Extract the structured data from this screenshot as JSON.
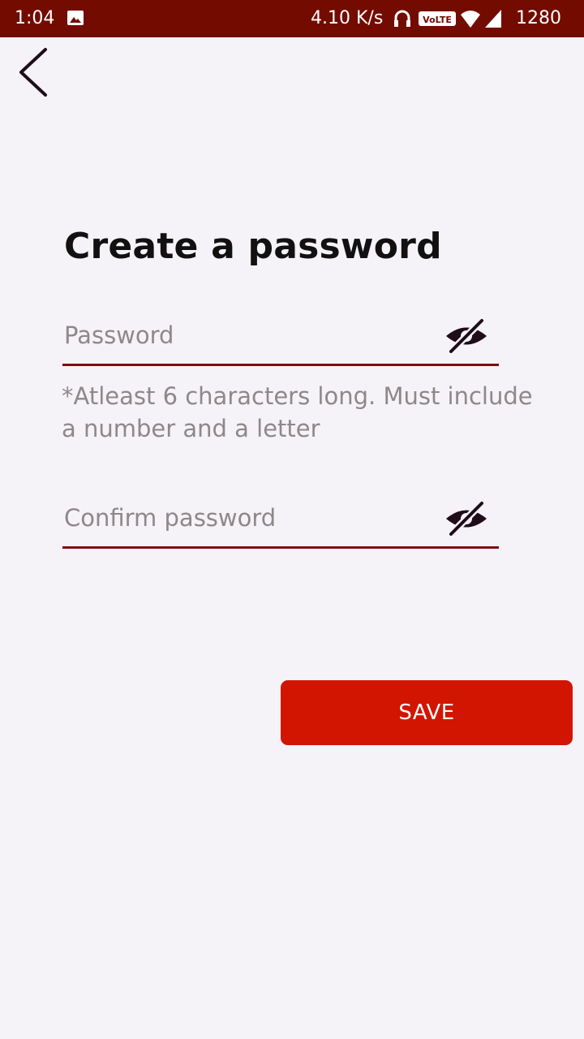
{
  "status_bar": {
    "time": "1:04",
    "network_speed": "4.10 K/s",
    "battery_text": "1280"
  },
  "icons": {
    "back": "chevron-left-icon",
    "visibility": "eye-off-icon",
    "gallery": "image-icon",
    "headset": "headset-icon",
    "volte": "volte-icon",
    "wifi": "wifi-icon",
    "signal": "signal-icon"
  },
  "form": {
    "title": "Create a password",
    "password": {
      "placeholder": "Password",
      "value": ""
    },
    "hint": "*Atleast 6 characters long. Must include a number and a letter",
    "confirm": {
      "placeholder": "Confirm password",
      "value": ""
    },
    "save_label": "SAVE"
  },
  "colors": {
    "status_bar_bg": "#730b00",
    "background": "#f5f3f8",
    "accent_underline": "#7a1010",
    "button_bg": "#d21500",
    "placeholder_text": "#8e8888"
  }
}
